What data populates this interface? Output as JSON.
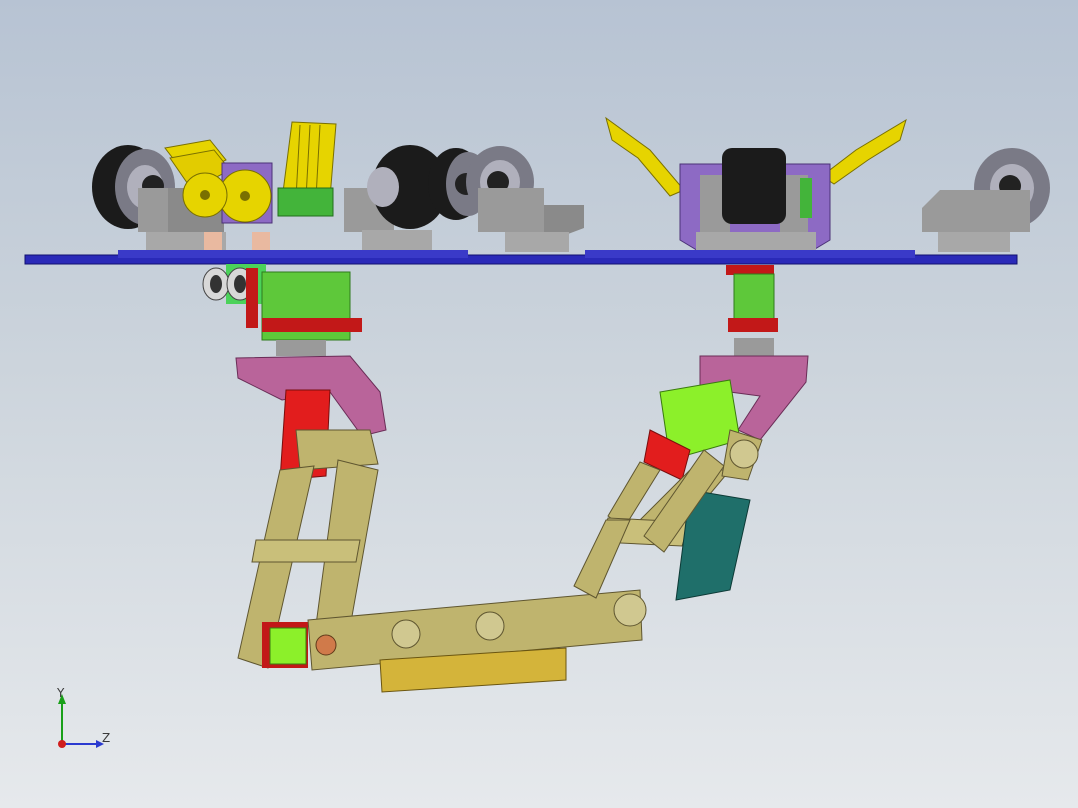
{
  "viewport": {
    "background_top": "#b7c3d3",
    "background_bottom": "#e6e9ec"
  },
  "model": {
    "parts": [
      "base-plate",
      "caster-wheels",
      "gripper-left",
      "gripper-right",
      "ultrasonic-sensor",
      "servo-motors",
      "arm-links",
      "battery-pack"
    ],
    "colors": {
      "base_plate": "#2a2ab8",
      "wheel_tire": "#1b1b1b",
      "wheel_hub": "#7a7a86",
      "caster_bracket": "#9a9a9a",
      "gripper": "#e6d400",
      "bracket_purple": "#8d6ac4",
      "servo_green": "#5ec83a",
      "servo_lime": "#8cf02a",
      "bracket_red": "#e21d1d",
      "arm_link": "#bfb46e",
      "arm_bracket_pink": "#b9649a",
      "battery": "#d4b43a",
      "board_teal": "#1f6f6a"
    }
  },
  "triad": {
    "y_label": "Y",
    "z_label": "Z",
    "icon": "axis-triad-icon"
  }
}
